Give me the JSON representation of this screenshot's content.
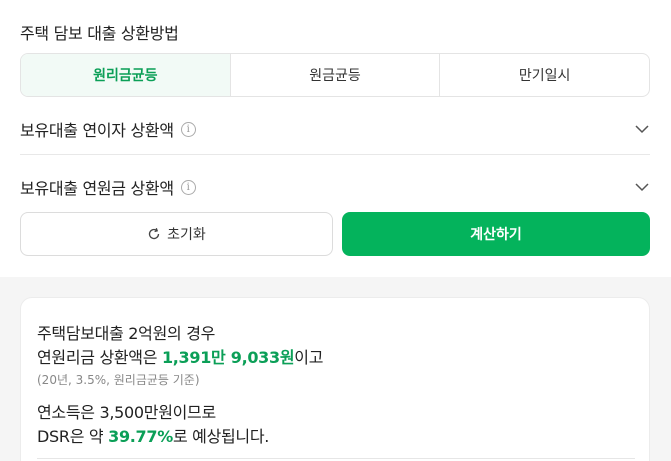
{
  "section_title": "주택 담보 대출 상환방법",
  "methods": [
    {
      "label": "원리금균등",
      "active": true
    },
    {
      "label": "원금균등",
      "active": false
    },
    {
      "label": "만기일시",
      "active": false
    }
  ],
  "rows": {
    "interest_label": "보유대출 연이자 상환액",
    "principal_label": "보유대출 연원금 상환액"
  },
  "buttons": {
    "reset_label": "초기화",
    "calc_label": "계산하기"
  },
  "result": {
    "line1": "주택담보대출 2억원의 경우",
    "line2_prefix": "연원리금 상환액은 ",
    "line2_value": "1,391만 9,033원",
    "line2_suffix": "이고",
    "line3": "(20년, 3.5%, 원리금균등 기준)",
    "line4": "연소득은 3,500만원이므로",
    "line5_prefix": "DSR은 약 ",
    "line5_value": "39.77%",
    "line5_suffix": "로 예상됩니다."
  },
  "colors": {
    "accent": "#04b35c",
    "accent_text": "#0b9f57"
  },
  "icons": {
    "info": "info-circle-icon",
    "chevron": "chevron-down-icon",
    "reset": "refresh-icon"
  }
}
